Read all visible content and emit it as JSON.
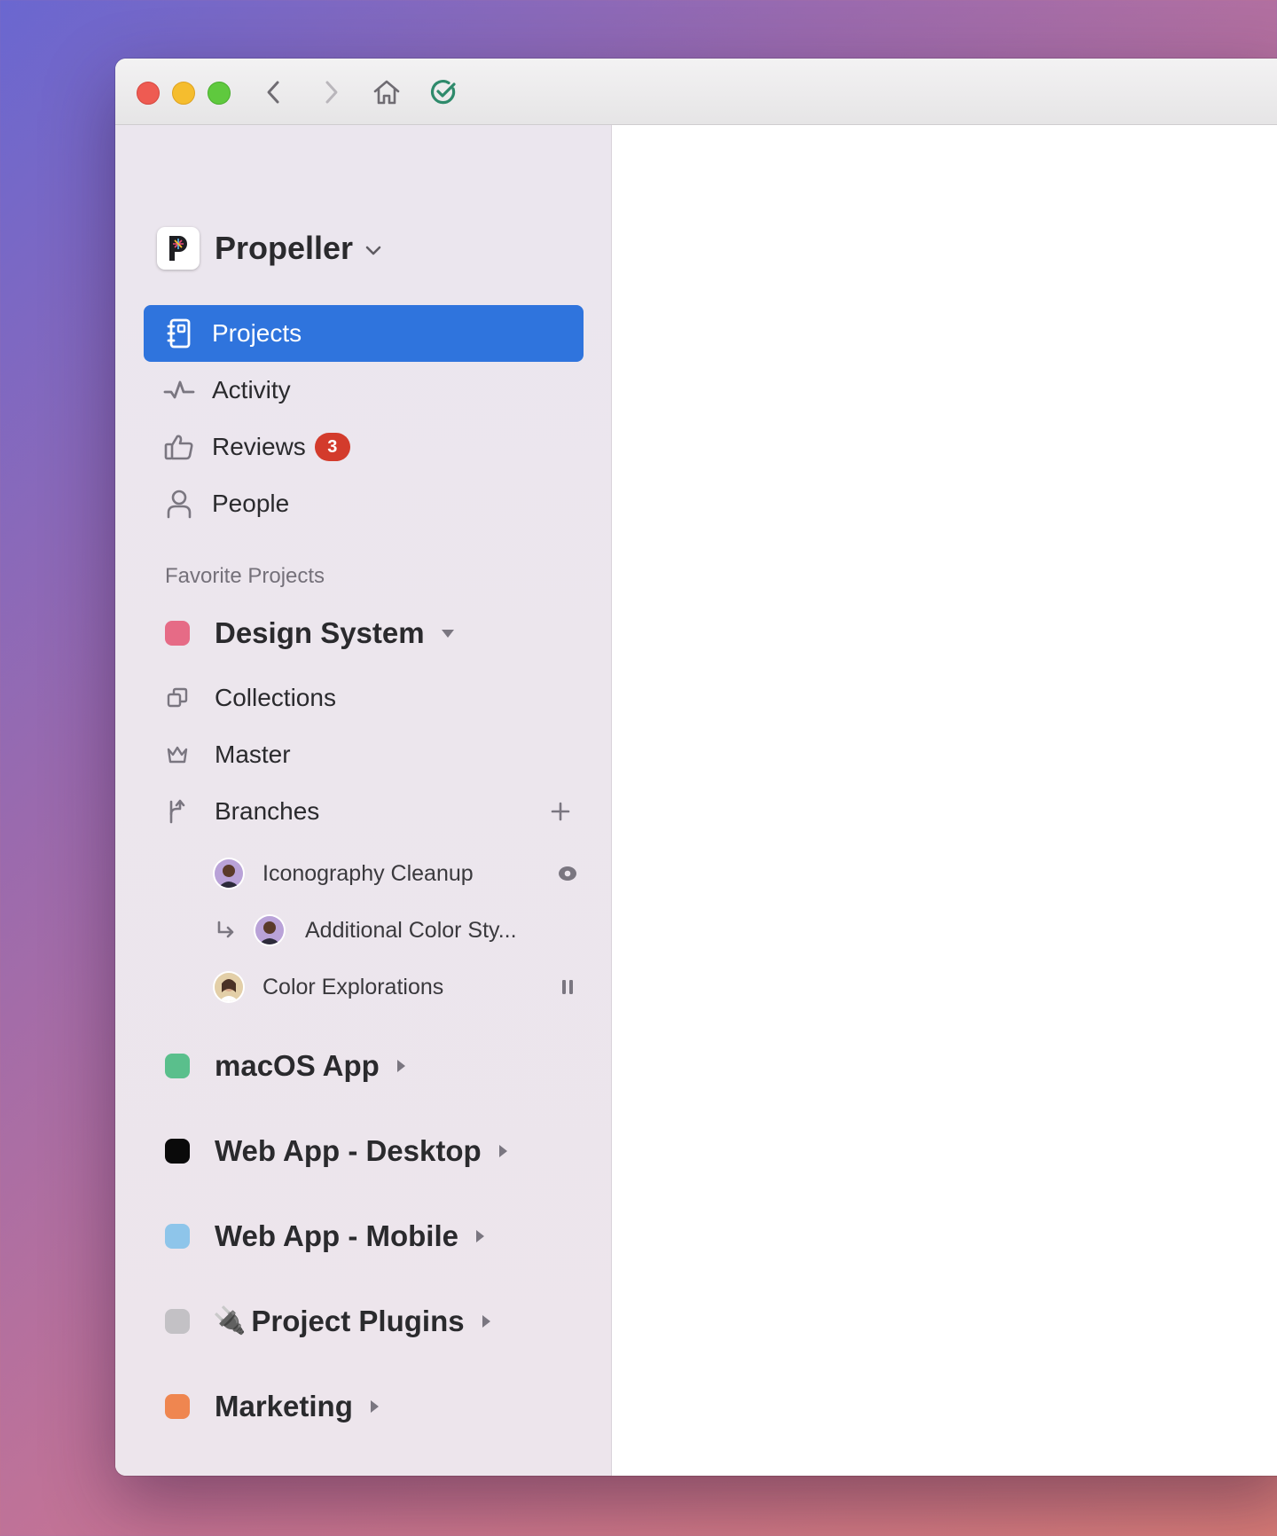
{
  "window": {
    "toolbar": {
      "back_icon": "chevron-left-icon",
      "forward_icon": "chevron-right-icon",
      "home_icon": "home-icon",
      "sync_icon": "check-circle-icon",
      "sync_color": "#2e8a6b"
    }
  },
  "sidebar": {
    "workspace": {
      "name": "Propeller"
    },
    "nav": [
      {
        "label": "Projects",
        "icon": "notebook-icon",
        "active": true
      },
      {
        "label": "Activity",
        "icon": "pulse-icon"
      },
      {
        "label": "Reviews",
        "icon": "thumbs-up-icon",
        "badge": "3"
      },
      {
        "label": "People",
        "icon": "person-icon"
      }
    ],
    "favorites_title": "Favorite Projects",
    "design_system": {
      "name": "Design System",
      "color": "#e66b86",
      "items": [
        {
          "label": "Collections",
          "icon": "collections-icon"
        },
        {
          "label": "Master",
          "icon": "crown-icon"
        },
        {
          "label": "Branches",
          "icon": "branch-icon",
          "action_icon": "plus-icon"
        }
      ],
      "branches": [
        {
          "label": "Iconography Cleanup",
          "status_icon": "eye-icon"
        },
        {
          "label": "Additional Color Sty...",
          "prefix_icon": "arrow-return-icon"
        },
        {
          "label": "Color Explorations",
          "status_icon": "pause-icon"
        }
      ]
    },
    "projects": [
      {
        "name": "macOS App",
        "color": "#5abf8c"
      },
      {
        "name": "Web App - Desktop",
        "color": "#0a0a0a"
      },
      {
        "name": "Web App - Mobile",
        "color": "#8ec5ea"
      },
      {
        "name": "Project Plugins",
        "color": "#c3c1c5",
        "emoji": "🔌"
      },
      {
        "name": "Marketing",
        "color": "#ef8650"
      }
    ]
  }
}
